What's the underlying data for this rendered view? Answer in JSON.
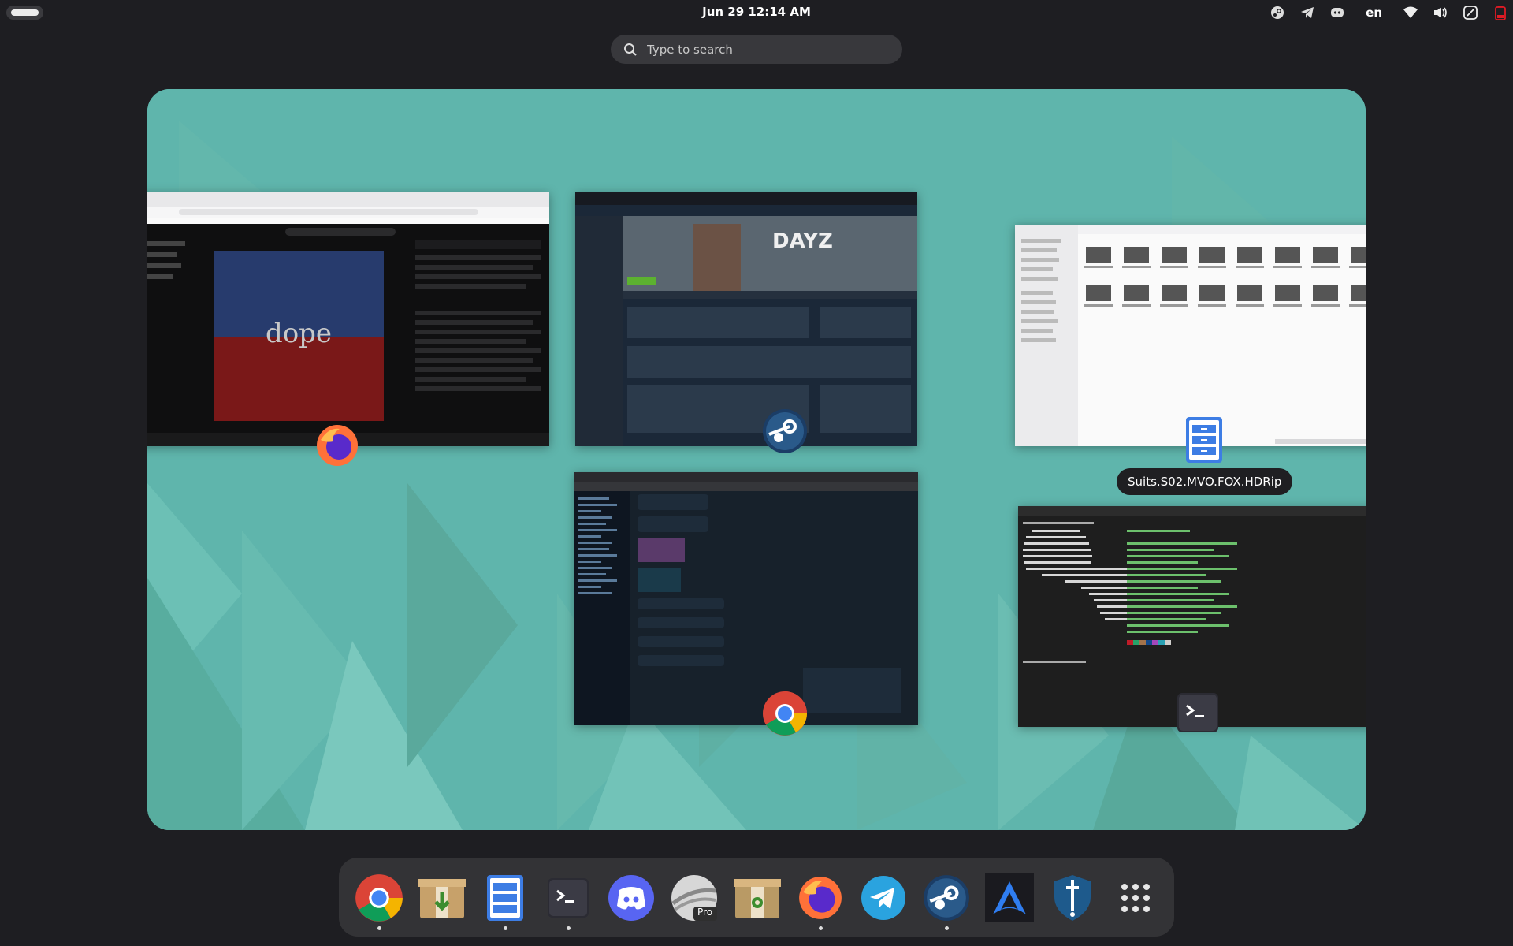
{
  "topbar": {
    "clock": "Jun 29  12:14 AM",
    "lang": "en"
  },
  "search": {
    "placeholder": "Type to search"
  },
  "overview": {
    "active_window_title": "Suits.S02.MVO.FOX.HDRip",
    "windows": [
      {
        "app": "Firefox",
        "icon": "firefox-icon"
      },
      {
        "app": "Steam",
        "icon": "steam-icon"
      },
      {
        "app": "Files",
        "icon": "files-icon"
      },
      {
        "app": "Google Chrome",
        "icon": "chrome-icon"
      },
      {
        "app": "Terminal",
        "icon": "terminal-icon"
      }
    ]
  },
  "dash": {
    "items": [
      {
        "name": "Google Chrome",
        "icon": "chrome-icon",
        "running": true
      },
      {
        "name": "Software Installer",
        "icon": "package-install-icon",
        "running": false
      },
      {
        "name": "Files",
        "icon": "files-icon",
        "running": true
      },
      {
        "name": "Terminal",
        "icon": "terminal-icon",
        "running": true
      },
      {
        "name": "Discord",
        "icon": "discord-icon",
        "running": false
      },
      {
        "name": "Google Earth Pro",
        "icon": "google-earth-pro-icon",
        "badge": "Pro",
        "running": false
      },
      {
        "name": "Archive Manager",
        "icon": "archive-icon",
        "running": false
      },
      {
        "name": "Firefox",
        "icon": "firefox-icon",
        "running": true
      },
      {
        "name": "Telegram",
        "icon": "telegram-icon",
        "running": false
      },
      {
        "name": "Steam",
        "icon": "steam-icon",
        "running": true
      },
      {
        "name": "Arch Linux",
        "icon": "arch-icon",
        "running": false
      },
      {
        "name": "Security Tool",
        "icon": "shield-sword-icon",
        "running": false
      },
      {
        "name": "Show Apps",
        "icon": "app-grid-icon",
        "running": false
      }
    ]
  },
  "colors": {
    "panel": "#1e1e22",
    "workspace": "#5fb5ac",
    "dash": "#333336",
    "chrome_red": "#db4437",
    "chrome_green": "#0f9d58",
    "chrome_yellow": "#f4b400",
    "chrome_blue": "#4285f4",
    "telegram": "#2aa3df",
    "discord": "#5865f2"
  }
}
